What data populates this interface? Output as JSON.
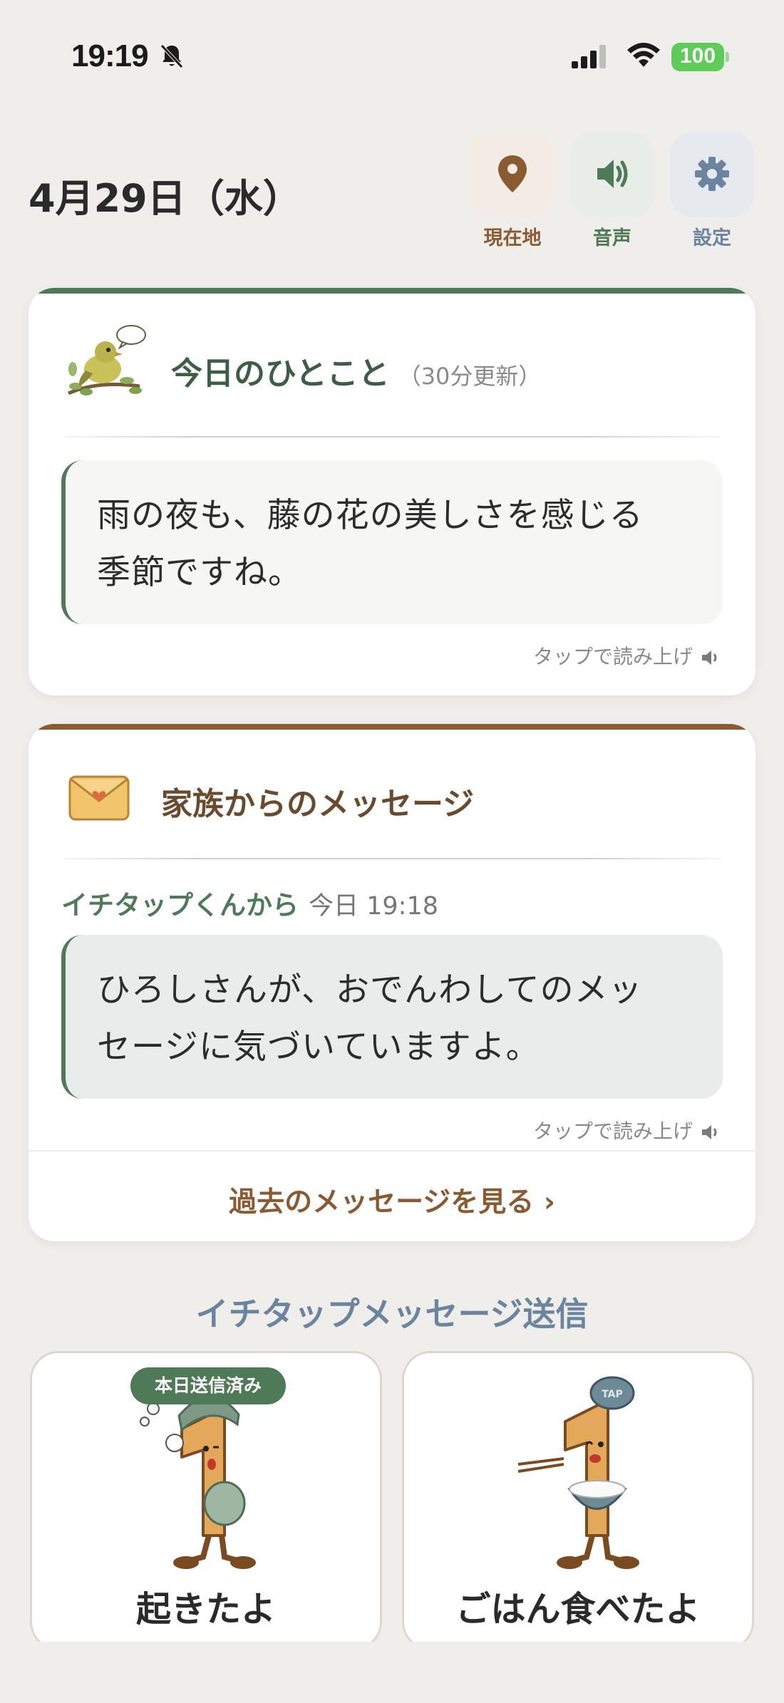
{
  "status_bar": {
    "time": "19:19",
    "battery": "100",
    "battery_color": "#5fcb59"
  },
  "header": {
    "date": "4月29日（水）",
    "buttons": [
      {
        "label": "現在地",
        "icon": "location-pin-icon",
        "color": "#8a5a33"
      },
      {
        "label": "音声",
        "icon": "speaker-icon",
        "color": "#4f7a58"
      },
      {
        "label": "設定",
        "icon": "gear-icon",
        "color": "#6b84a0"
      }
    ]
  },
  "daily_word": {
    "title": "今日のひとこと",
    "subtitle": "（30分更新）",
    "icon": "bird-icon",
    "text_line1": "雨の夜も、藤の花の美しさを感じる",
    "text_line2": "季節ですね。",
    "tts_label": "タップで読み上げ",
    "accent_color": "#4f7a58"
  },
  "family_messages": {
    "title": "家族からのメッセージ",
    "icon": "envelope-icon",
    "sender": "イチタップくんから",
    "time": "今日 19:18",
    "text_line1": "ひろしさんが、おでんわしてのメッ",
    "text_line2": "セージに気づいていますよ。",
    "tts_label": "タップで読み上げ",
    "past_link": "過去のメッセージを見る ›",
    "accent_color": "#8a5a33"
  },
  "one_tap": {
    "section_title": "イチタップメッセージ送信",
    "tiles": [
      {
        "label": "起きたよ",
        "badge": "本日送信済み",
        "icon": "wake-up-character-icon"
      },
      {
        "label": "ごはん食べたよ",
        "icon": "eating-character-icon",
        "cap_text": "TAP"
      }
    ]
  }
}
